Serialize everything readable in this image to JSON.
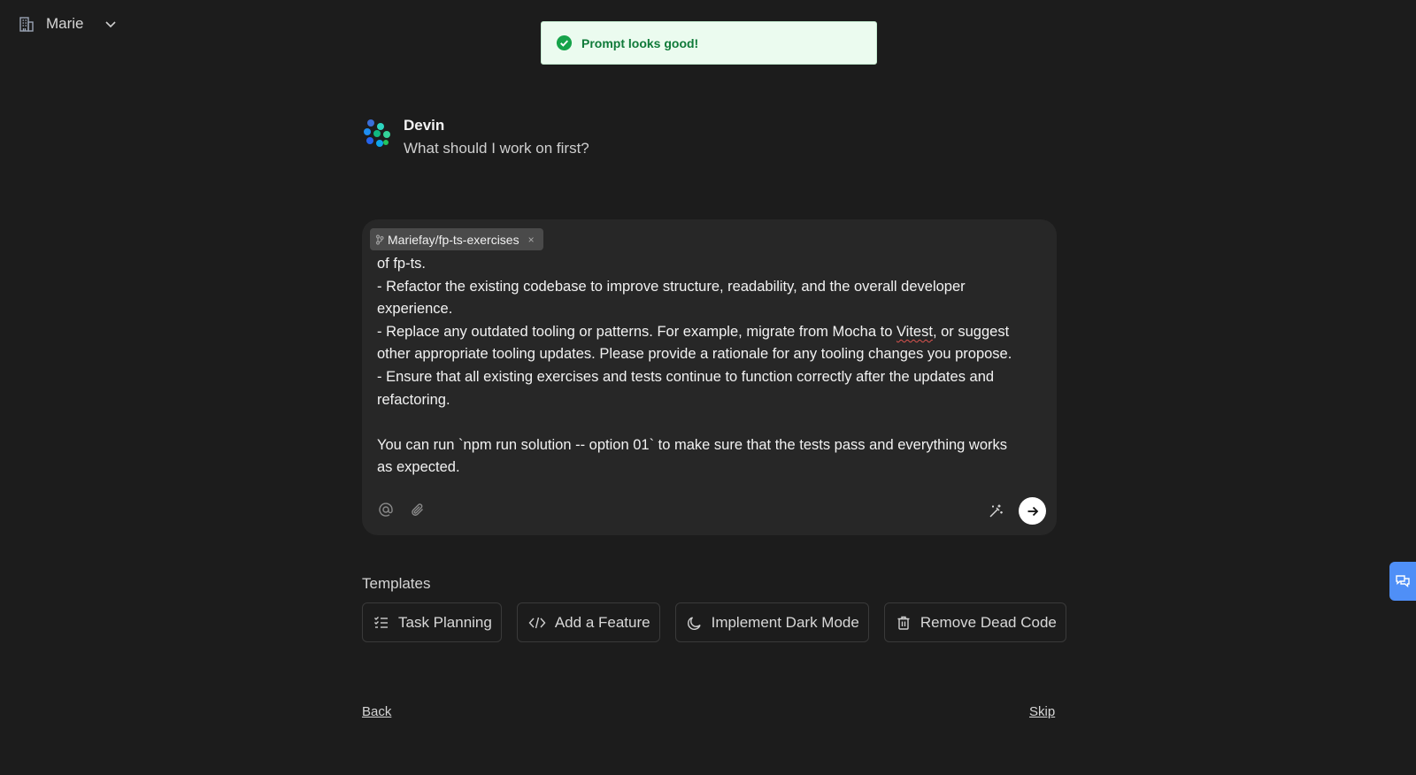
{
  "org": {
    "name": "Marie",
    "icon": "building-icon"
  },
  "toast": {
    "message": "Prompt looks good!",
    "status_color": "#16a34a"
  },
  "greeting": {
    "agent_name": "Devin",
    "question": "What should I work on first?"
  },
  "prompt": {
    "repo_chip": "Mariefay/fp-ts-exercises",
    "lines": [
      "of fp-ts.",
      "- Refactor the existing codebase to improve structure, readability, and the overall developer",
      "experience.",
      "- Replace any outdated tooling or patterns. For example, migrate from Mocha to ",
      "other appropriate tooling updates. Please provide a rationale for any tooling changes you propose.",
      "- Ensure that all existing exercises and tests continue to function correctly after the updates and",
      "refactoring.",
      "",
      "You can run `npm run solution -- option 01` to make sure that the tests pass and everything works",
      "as expected."
    ],
    "spell_word": "Vitest",
    "spell_tail": ", or suggest"
  },
  "templates": {
    "title": "Templates",
    "items": [
      {
        "label": "Task Planning",
        "icon": "checklist-icon"
      },
      {
        "label": "Add a Feature",
        "icon": "code-icon"
      },
      {
        "label": "Implement Dark Mode",
        "icon": "moon-icon"
      },
      {
        "label": "Remove Dead Code",
        "icon": "trash-icon"
      }
    ]
  },
  "footer": {
    "back": "Back",
    "skip": "Skip"
  },
  "colors": {
    "background": "#1c1c1c",
    "prompt_bg": "#272727",
    "feedback_tab": "#4f8ff7",
    "toast_bg": "#ebfbef"
  }
}
